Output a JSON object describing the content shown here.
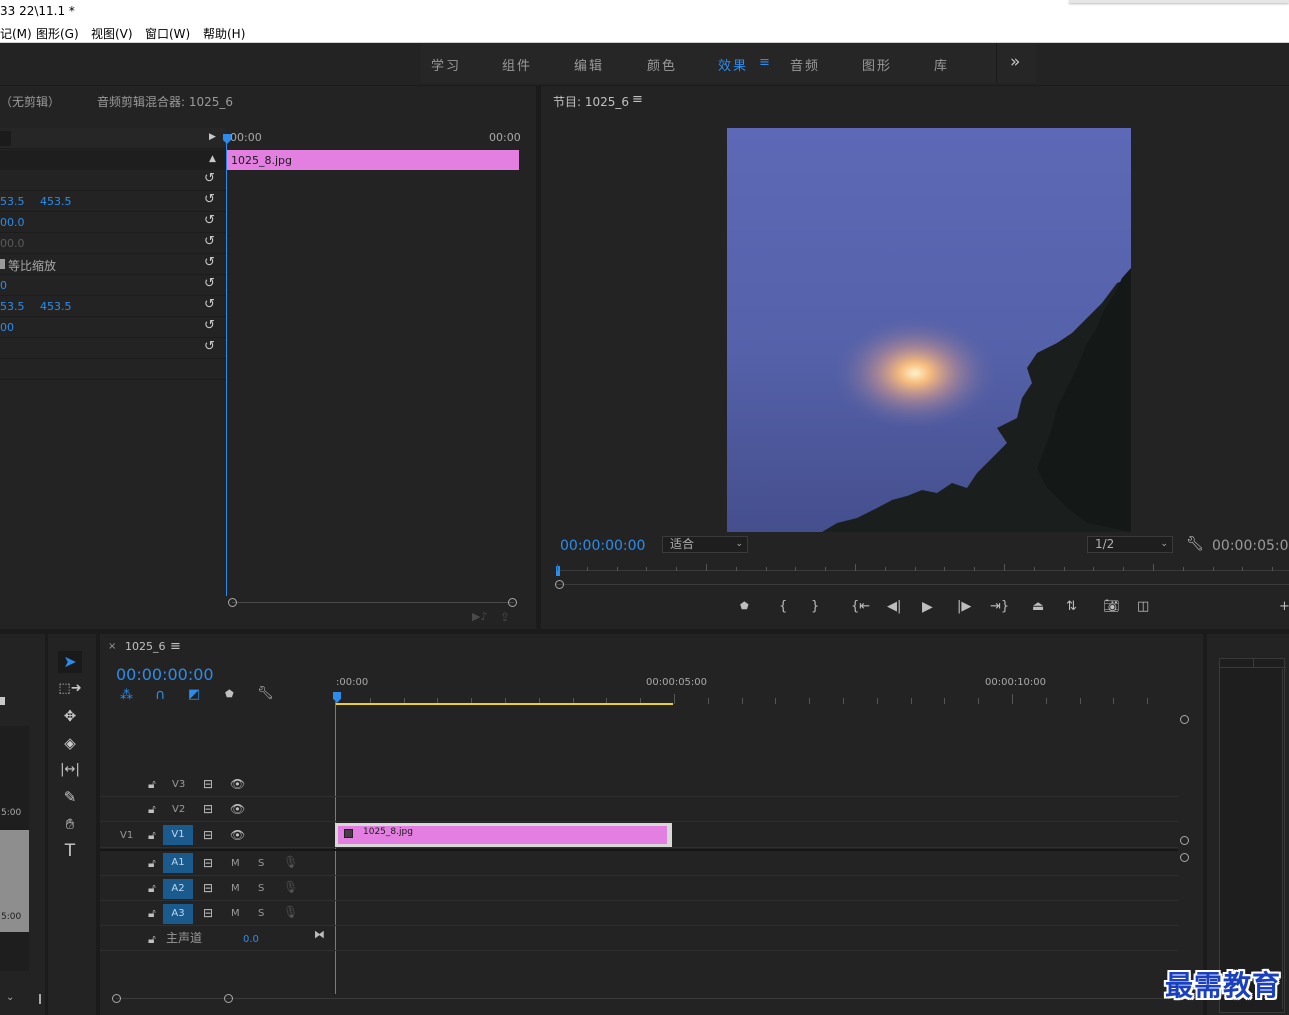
{
  "window": {
    "title": "33 22\\11.1 *"
  },
  "menubar": [
    {
      "label": "记(M)"
    },
    {
      "label": "图形(G)"
    },
    {
      "label": "视图(V)"
    },
    {
      "label": "窗口(W)"
    },
    {
      "label": "帮助(H)"
    }
  ],
  "workspaces": {
    "tabs": [
      "学习",
      "组件",
      "编辑",
      "颜色",
      "效果",
      "音频",
      "图形",
      "库"
    ],
    "active": "效果",
    "more": "»"
  },
  "source_panel": {
    "tab_no_clip": "（无剪辑）",
    "tab_mixer": "音频剪辑混合器: 1025_6",
    "ruler_start": "00:00",
    "ruler_end": "00:00",
    "clip_name": "1025_8.jpg",
    "rows": [
      {
        "v1": "",
        "v2": ""
      },
      {
        "v1": "53.5",
        "v2": "453.5"
      },
      {
        "v1": "00.0",
        "v2": ""
      },
      {
        "v1": "00.0",
        "v2": ""
      },
      {
        "v1": "",
        "v2": "",
        "label": "等比缩放"
      },
      {
        "v1": "0",
        "v2": ""
      },
      {
        "v1": "53.5",
        "v2": "453.5"
      },
      {
        "v1": "00",
        "v2": ""
      },
      {
        "v1": "",
        "v2": ""
      }
    ]
  },
  "program_panel": {
    "title": "节目: 1025_6",
    "timecode": "00:00:00:00",
    "zoom": "适合",
    "resolution": "1/2",
    "duration": "00:00:05:00"
  },
  "project_panel": {
    "mark_top": "5:00",
    "mark_bottom": "5:00"
  },
  "timeline": {
    "sequence": "1025_6",
    "timecode": "00:00:00:00",
    "ruler": [
      ":00:00",
      "00:00:05:00",
      "00:00:10:00"
    ],
    "tracks_video": [
      {
        "name": "V3",
        "src": ""
      },
      {
        "name": "V2",
        "src": ""
      },
      {
        "name": "V1",
        "src": "V1"
      }
    ],
    "tracks_audio": [
      {
        "name": "A1",
        "m": "M",
        "s": "S"
      },
      {
        "name": "A2",
        "m": "M",
        "s": "S"
      },
      {
        "name": "A3",
        "m": "M",
        "s": "S"
      }
    ],
    "master": {
      "label": "主声道",
      "value": "0.0"
    },
    "clip_name": "1025_8.jpg"
  },
  "watermark": "最需教育",
  "colors": {
    "accent": "#2d8ceb",
    "clip": "#e37fe0",
    "work_area": "#e8d21d",
    "panel": "#232323"
  }
}
